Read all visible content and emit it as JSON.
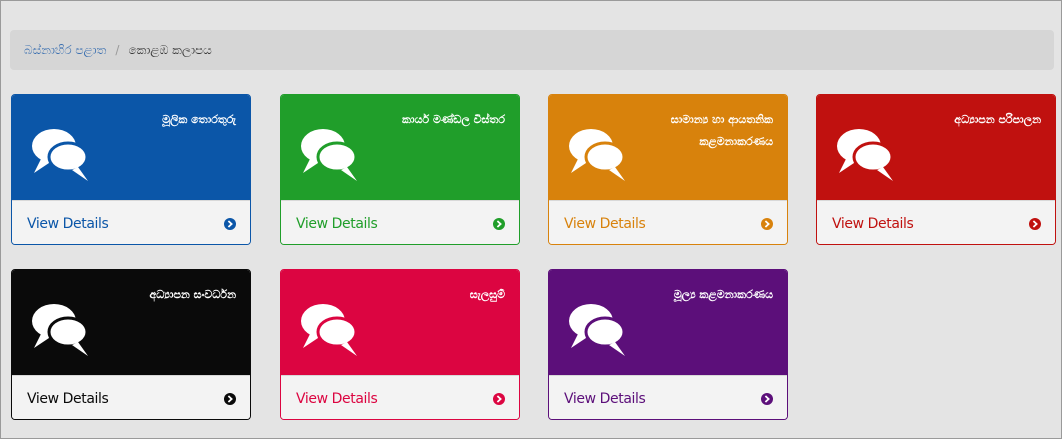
{
  "breadcrumb": {
    "home": "බස්නාහිර පළාත",
    "separator": "/",
    "current": "කොළඹ කලාපය"
  },
  "details_label": "View Details",
  "icons": {
    "panel": "comments-icon",
    "footer": "arrow-circle-right-icon"
  },
  "panels": [
    {
      "title": "මූලික තොරතුරු",
      "color": "#0b56a8"
    },
    {
      "title": "කාර්ය මණ්ඩල විස්තර",
      "color": "#209e2a"
    },
    {
      "title": "සාමාන්‍ය හා ආයතනික කළමනාකරණය",
      "color": "#d8820c"
    },
    {
      "title": "අධ්‍යාපන පරිපාලන",
      "color": "#c0110f"
    },
    {
      "title": "අධ්‍යාපන සංවර්ධන",
      "color": "#0a0a0a"
    },
    {
      "title": "සැලසුම්",
      "color": "#dc0541"
    },
    {
      "title": "මූල්‍ය කළමනාකරණය",
      "color": "#5c0f7a"
    }
  ]
}
